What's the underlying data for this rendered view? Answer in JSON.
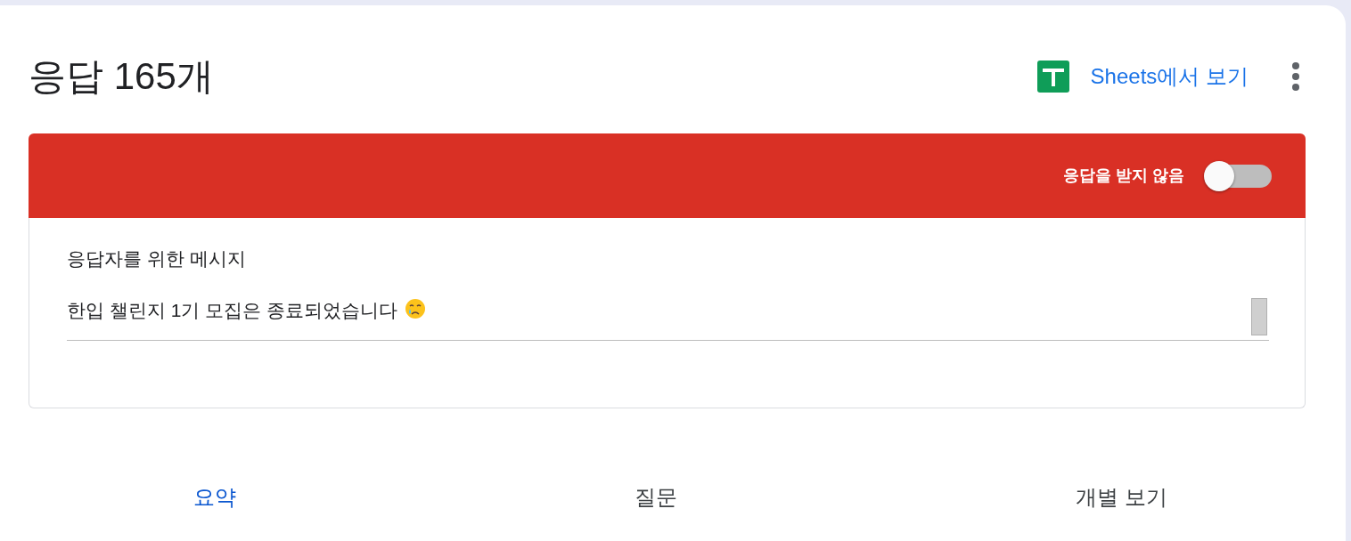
{
  "title": "응답 165개",
  "sheets_link": "Sheets에서 보기",
  "accepting": {
    "label": "응답을 받지 않음",
    "on": false
  },
  "message": {
    "label": "응답자를 위한 메시지",
    "value": "한입 챌린지 1기 모집은 종료되었습니다"
  },
  "tabs": [
    {
      "label": "요약",
      "selected": true
    },
    {
      "label": "질문",
      "selected": false
    },
    {
      "label": "개별 보기",
      "selected": false
    }
  ]
}
